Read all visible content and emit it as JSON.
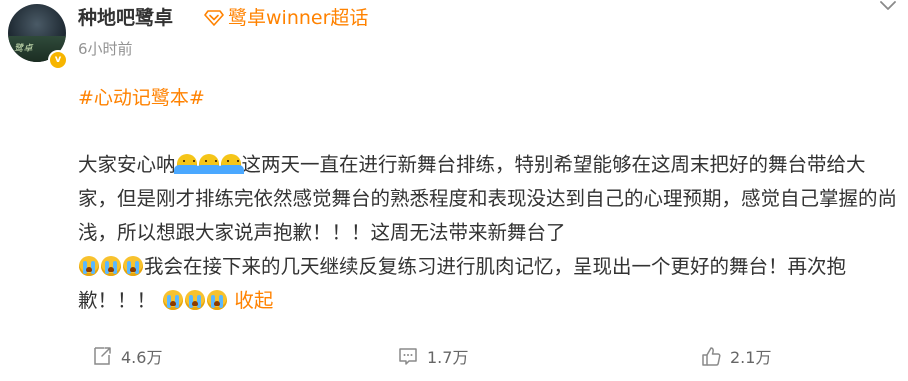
{
  "post": {
    "username": "种地吧鹭卓",
    "supertopic": "鹭卓winner超话",
    "timestamp": "6小时前",
    "hashtag": "#心动记鹭本#",
    "verified_badge": "v",
    "avatar_text": "鹭卓",
    "content": {
      "seg1": "大家安心呐",
      "seg2": "这两天一直在进行新舞台排练，特别希望能够在这周末把好的舞台带给大家，但是刚才排练完依然感觉舞台的熟悉程度和表现没达到自己的心理预期，感觉自己掌握的尚浅，所以想跟大家说声抱歉！！！这周无法带来新舞台了",
      "seg3": "我会在接下来的几天继续反复练习进行肌肉记忆，呈现出一个更好的舞台！再次抱歉！！！",
      "collapse_label": "收起"
    }
  },
  "actions": {
    "repost_count": "4.6万",
    "comment_count": "1.7万",
    "like_count": "2.1万"
  },
  "colors": {
    "accent": "#ff8200",
    "text": "#333333",
    "muted": "#939393",
    "badge": "#f7b500"
  },
  "icons": {
    "supertopic": "diamond-icon",
    "menu": "chevron-down-icon",
    "repost": "repost-icon",
    "comment": "comment-icon",
    "like": "thumbs-up-icon",
    "emoji_a": "shrug-emoji-icon",
    "emoji_b": "crying-emoji-icon"
  }
}
